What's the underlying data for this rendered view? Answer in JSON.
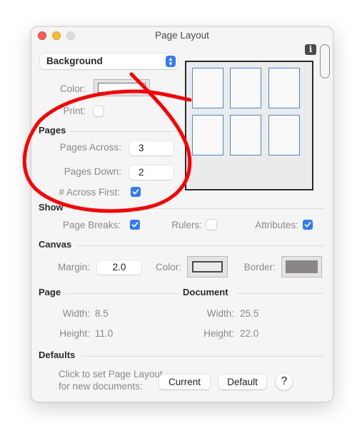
{
  "window": {
    "title": "Page Layout"
  },
  "background_popup": {
    "selected": "Background"
  },
  "background": {
    "color_label": "Color:",
    "color_value": "#ffffff",
    "print_label": "Print:",
    "print_checked": false
  },
  "pages": {
    "section": "Pages",
    "across_label": "Pages Across:",
    "across_value": "3",
    "down_label": "Pages Down:",
    "down_value": "2",
    "across_first_label": "# Across First:",
    "across_first_checked": true
  },
  "preview": {
    "columns": 3,
    "rows": 2,
    "page_border_color": "#3d8ef8"
  },
  "show": {
    "section": "Show",
    "page_breaks_label": "Page Breaks:",
    "page_breaks_checked": true,
    "rulers_label": "Rulers:",
    "rulers_checked": false,
    "attributes_label": "Attributes:",
    "attributes_checked": true
  },
  "canvas": {
    "section": "Canvas",
    "margin_label": "Margin:",
    "margin_value": "2.0",
    "color_label": "Color:",
    "color_value": "#ebebeb",
    "border_label": "Border:",
    "border_value": "#8a8685"
  },
  "page": {
    "section": "Page",
    "width_label": "Width:",
    "width_value": "8.5",
    "height_label": "Height:",
    "height_value": "11.0"
  },
  "document": {
    "section": "Document",
    "width_label": "Width:",
    "width_value": "25.5",
    "height_label": "Height:",
    "height_value": "22.0"
  },
  "defaults": {
    "section": "Defaults",
    "description_line1": "Click to set Page Layout",
    "description_line2": "for new documents:",
    "current_button": "Current",
    "default_button": "Default",
    "help_button": "?"
  },
  "icons": {
    "info": "i",
    "popup_arrows": "chevron-up-down",
    "checkmark": "checkmark"
  },
  "annotation": {
    "color": "#ff0000",
    "shape": "freehand-loop"
  }
}
